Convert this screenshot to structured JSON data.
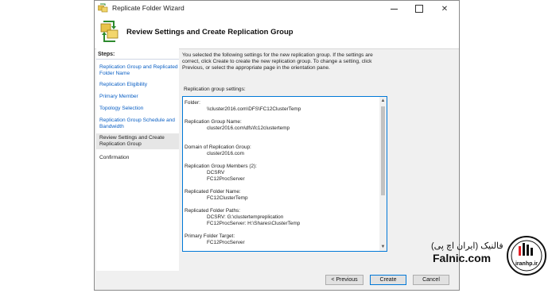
{
  "window": {
    "title": "Replicate Folder Wizard",
    "minimize_glyph": "—",
    "maximize_glyph": "□",
    "close_glyph": "✕"
  },
  "header": {
    "title": "Review Settings and Create Replication Group",
    "icon": "replication-wizard-icon"
  },
  "steps": {
    "heading": "Steps:",
    "items": [
      {
        "label": "Replication Group and Replicated Folder Name"
      },
      {
        "label": "Replication Eligibility"
      },
      {
        "label": "Primary Member"
      },
      {
        "label": "Topology Selection"
      },
      {
        "label": "Replication Group Schedule and Bandwidth"
      },
      {
        "label": "Review Settings and Create Replication Group"
      },
      {
        "label": "Confirmation"
      }
    ]
  },
  "content": {
    "intro": "You selected the following settings for the new replication group. If the settings are correct, click Create to create the new replication group. To change a setting, click Previous, or select the appropriate page in the orientation pane.",
    "settings_label": "Replication group settings:",
    "settings": [
      {
        "label": "Folder:",
        "values": [
          "\\\\cluster2016.com\\DFS\\FC12ClusterTemp"
        ]
      },
      {
        "label": "Replication Group Name:",
        "values": [
          "cluster2016.com\\dfs\\fc12clustertemp"
        ]
      },
      {
        "label": "Domain of Replication Group:",
        "values": [
          "cluster2016.com"
        ]
      },
      {
        "label": "Replication Group Members (2):",
        "values": [
          "DCSRV",
          "FC12ProcServer"
        ]
      },
      {
        "label": "Replicated Folder Name:",
        "values": [
          "FC12ClusterTemp"
        ]
      },
      {
        "label": "Replicated Folder Paths:",
        "values": [
          "DCSRV: G:\\clustertempreplication",
          "FC12ProcServer: H:\\Shares\\ClusterTemp"
        ]
      },
      {
        "label": "Primary Folder Target:",
        "values": [
          "FC12ProcServer"
        ]
      }
    ]
  },
  "buttons": {
    "previous": "< Previous",
    "create": "Create",
    "cancel": "Cancel"
  },
  "brand": {
    "name_fa": "فالنیک (ایران اچ پی)",
    "name_en": "Falnic.com",
    "logo_text": "iranhp.ir",
    "logo": "iranhp-logo"
  },
  "colors": {
    "accent": "#0078d7",
    "link": "#0a5fc4",
    "brand_red": "#e31e24"
  }
}
